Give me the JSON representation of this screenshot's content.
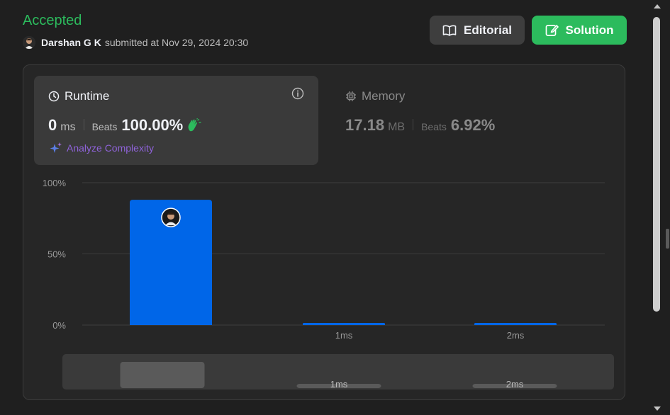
{
  "submission": {
    "status": "Accepted",
    "user": "Darshan G K",
    "submitted_text": "submitted at Nov 29, 2024 20:30"
  },
  "buttons": {
    "editorial": "Editorial",
    "solution": "Solution"
  },
  "runtime": {
    "title": "Runtime",
    "value": "0",
    "unit": "ms",
    "beats_label": "Beats",
    "beats_value": "100.00%",
    "analyze_label": "Analyze Complexity"
  },
  "memory": {
    "title": "Memory",
    "value": "17.18",
    "unit": "MB",
    "beats_label": "Beats",
    "beats_value": "6.92%"
  },
  "colors": {
    "accepted": "#2cbb5d",
    "bar": "#0066e8",
    "mini_bar": "#5a5a5a",
    "analyze": "#8f63d9"
  },
  "icons": {
    "editorial": "book-open-icon",
    "solution": "edit-icon",
    "runtime": "clock-icon",
    "memory": "chip-icon",
    "info": "info-icon",
    "beats": "clapping-hands-icon",
    "analyze": "sparkle-icon"
  },
  "chart_data": {
    "type": "bar",
    "categories": [
      "",
      "1ms",
      "2ms"
    ],
    "values": [
      88,
      1.5,
      1.5
    ],
    "ylim": [
      0,
      100
    ],
    "ytick_labels": [
      "100%",
      "50%",
      "0%"
    ],
    "yticks": [
      100,
      50,
      0
    ],
    "grid": true,
    "highlight_index": 0
  },
  "mini_chart": {
    "categories": [
      "",
      "1ms",
      "2ms"
    ],
    "values": [
      88,
      1.5,
      1.5
    ]
  }
}
